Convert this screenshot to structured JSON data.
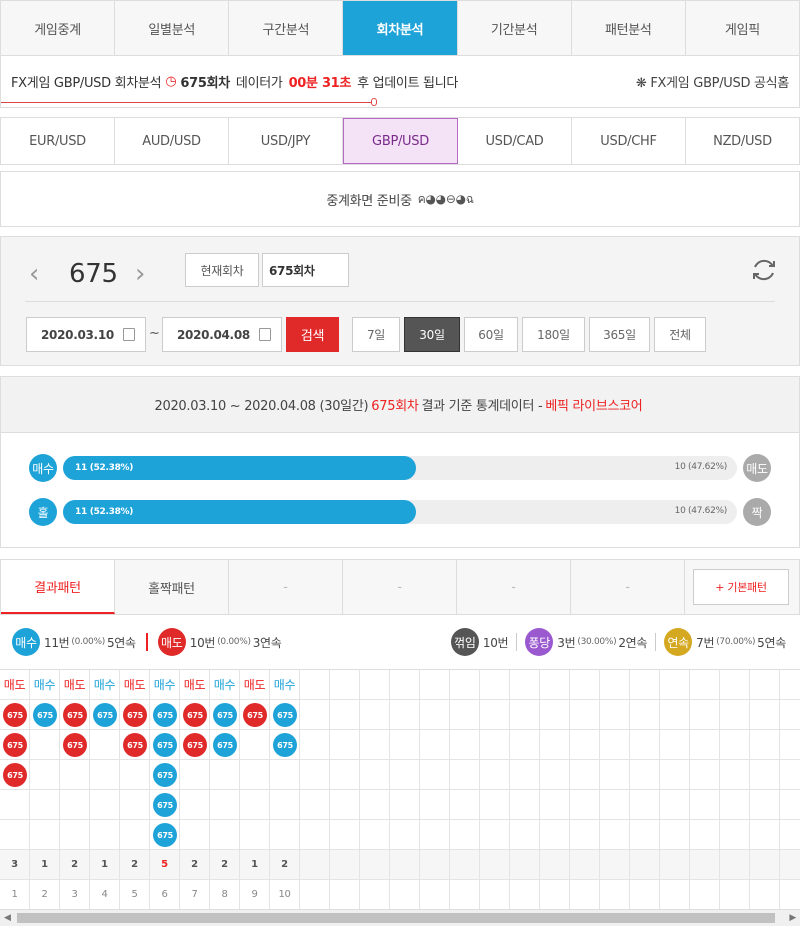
{
  "nav_tabs": [
    "게임중계",
    "일별분석",
    "구간분석",
    "회차분석",
    "기간분석",
    "패턴분석",
    "게임픽"
  ],
  "active_tab": 3,
  "info": {
    "prefix": "FX게임 GBP/USD 회차분석",
    "round": "675회차",
    "middle": "데이터가",
    "countdown": "00분 31초",
    "suffix": "후 업데이트 됩니다",
    "homepage": "FX게임 GBP/USD 공식홈"
  },
  "pairs": [
    "EUR/USD",
    "AUD/USD",
    "USD/JPY",
    "GBP/USD",
    "USD/CAD",
    "USD/CHF",
    "NZD/USD"
  ],
  "active_pair": 3,
  "relay": {
    "text": "중계화면 준비중",
    "loading": "ค◕◕⊖◕ฉ"
  },
  "search": {
    "round": "675",
    "current_btn": "현재회차",
    "round_value": "675회차",
    "date_from": "2020.03.10",
    "date_to": "2020.04.08",
    "search_btn": "검색",
    "periods": [
      "7일",
      "30일",
      "60일",
      "180일",
      "365일",
      "전체"
    ],
    "active_period": 1
  },
  "stats": {
    "range": "2020.03.10 ~ 2020.04.08 (30일간)",
    "round": "675회차",
    "desc": "결과 기준 통계데이터 -",
    "source": "베픽 라이브스코어",
    "rows": [
      {
        "left_label": "매수",
        "right_label": "매도",
        "left_text": "11 (52.38%)",
        "right_text": "10 (47.62%)",
        "left_ratio": 0.5238,
        "left_color": "#1ea3d8",
        "right_color": "#aaaaaa"
      },
      {
        "left_label": "홀",
        "right_label": "짝",
        "left_text": "11 (52.38%)",
        "right_text": "10 (47.62%)",
        "left_ratio": 0.5238,
        "left_color": "#1ea3d8",
        "right_color": "#aaaaaa"
      }
    ]
  },
  "result_tabs": [
    "결과패턴",
    "홀짝패턴",
    "-",
    "-",
    "-",
    "-"
  ],
  "basic_pattern_btn": "+ 기본패턴",
  "legend": {
    "buy": {
      "label": "매수",
      "count": "11번",
      "pct": "(0.00%)",
      "streak": "5연속",
      "color": "#1ea3d8"
    },
    "sell": {
      "label": "매도",
      "count": "10번",
      "pct": "(0.00%)",
      "streak": "3연속",
      "color": "#e02a2a"
    },
    "break": {
      "label": "꺾임",
      "count": "10번",
      "color": "#555555"
    },
    "bounce": {
      "label": "퐁당",
      "count": "3번",
      "pct": "(30.00%)",
      "streak": "2연속",
      "color": "#9b59d0"
    },
    "cont": {
      "label": "연속",
      "count": "7번",
      "pct": "(70.00%)",
      "streak": "5연속",
      "color": "#d4a820"
    }
  },
  "pattern": {
    "headers": [
      "매도",
      "매수",
      "매도",
      "매수",
      "매도",
      "매수",
      "매도",
      "매수",
      "매도",
      "매수"
    ],
    "types": [
      "sell",
      "buy",
      "sell",
      "buy",
      "sell",
      "buy",
      "sell",
      "buy",
      "sell",
      "buy"
    ],
    "counts": [
      3,
      1,
      2,
      1,
      2,
      5,
      2,
      2,
      1,
      2
    ],
    "max_index": 5,
    "ball_label": "675",
    "indices": [
      "1",
      "2",
      "3",
      "4",
      "5",
      "6",
      "7",
      "8",
      "9",
      "10"
    ]
  }
}
